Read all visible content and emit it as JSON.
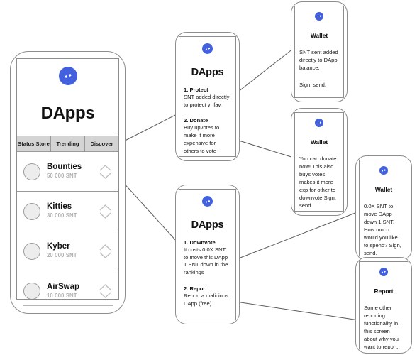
{
  "brand": {
    "accent": "#4360df",
    "logo_icon": "status-lightning-icon"
  },
  "main_phone": {
    "logo_icon": "status-lightning-icon",
    "title": "DApps",
    "tabs": [
      {
        "label": "Status Store"
      },
      {
        "label": "Trending"
      },
      {
        "label": "Discover"
      }
    ],
    "rows": [
      {
        "name": "Bounties",
        "amount": "50 000 SNT"
      },
      {
        "name": "Kitties",
        "amount": "30 000 SNT"
      },
      {
        "name": "Kyber",
        "amount": "20 000 SNT"
      },
      {
        "name": "AirSwap",
        "amount": "10 000 SNT"
      }
    ]
  },
  "dapps_upvote_card": {
    "logo_icon": "status-lightning-icon",
    "title": "DApps",
    "steps": [
      {
        "head": "1. Protect",
        "body": "SNT added directly to protect yr fav."
      },
      {
        "head": "2. Donate",
        "body": "Buy upvotes to make it more expensive for others to vote"
      }
    ]
  },
  "dapps_downvote_card": {
    "logo_icon": "status-lightning-icon",
    "title": "DApps",
    "steps": [
      {
        "head": "1. Downvote",
        "body": "It costs 0.0X SNT to move this DApp 1 SNT down in the rankings"
      },
      {
        "head": "2. Report",
        "body": "Report a malicious DApp (free)."
      }
    ]
  },
  "wallet_protect_card": {
    "logo_icon": "status-lightning-icon",
    "title": "Wallet",
    "body": "SNT sent added directly to DApp balance.",
    "body2": "Sign, send."
  },
  "wallet_donate_card": {
    "logo_icon": "status-lightning-icon",
    "title": "Wallet",
    "body": "You can donate now! This also buys votes, makes it more exp for other to downvote Sign, send."
  },
  "wallet_downvote_card": {
    "logo_icon": "status-lightning-icon",
    "title": "Wallet",
    "body": "0.0X SNT to move DApp down 1 SNT. How much would you like to spend? Sign, send."
  },
  "report_card": {
    "logo_icon": "status-lightning-icon",
    "title": "Report",
    "body": "Some other reporting functionality in this screen about why you want to report."
  }
}
